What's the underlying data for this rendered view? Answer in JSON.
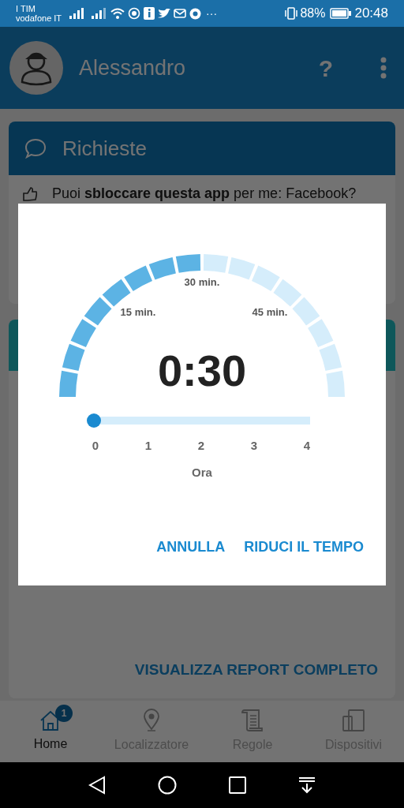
{
  "status_bar": {
    "carriers": [
      "I TIM",
      "vodafone IT"
    ],
    "more": "···",
    "battery": "88%",
    "time": "20:48"
  },
  "header": {
    "name": "Alessandro",
    "help": "?"
  },
  "requests_card": {
    "title": "Richieste",
    "message": "Puoi **sbloccare questa app** per me: Facebook?"
  },
  "report_card": {
    "link": "VISUALIZZA REPORT COMPLETO"
  },
  "dialog": {
    "gauge": {
      "level": 0.5,
      "labels": [
        "15 min.",
        "30 min.",
        "45 min."
      ]
    },
    "time": "0:30",
    "slider": {
      "level": 0,
      "ticks": [
        "0",
        "1",
        "2",
        "3",
        "4"
      ],
      "unit": "Ora"
    },
    "buttons": [
      "ANNULLA",
      "RIDUCI IL TEMPO"
    ]
  },
  "nav": [
    {
      "kind": "home",
      "label": "Home",
      "selected": true,
      "badge": "1"
    },
    {
      "kind": "pin",
      "label": "Localizzatore",
      "selected": false
    },
    {
      "kind": "scroll",
      "label": "Regole",
      "selected": false
    },
    {
      "kind": "devices",
      "label": "Dispositivi",
      "selected": false
    }
  ]
}
